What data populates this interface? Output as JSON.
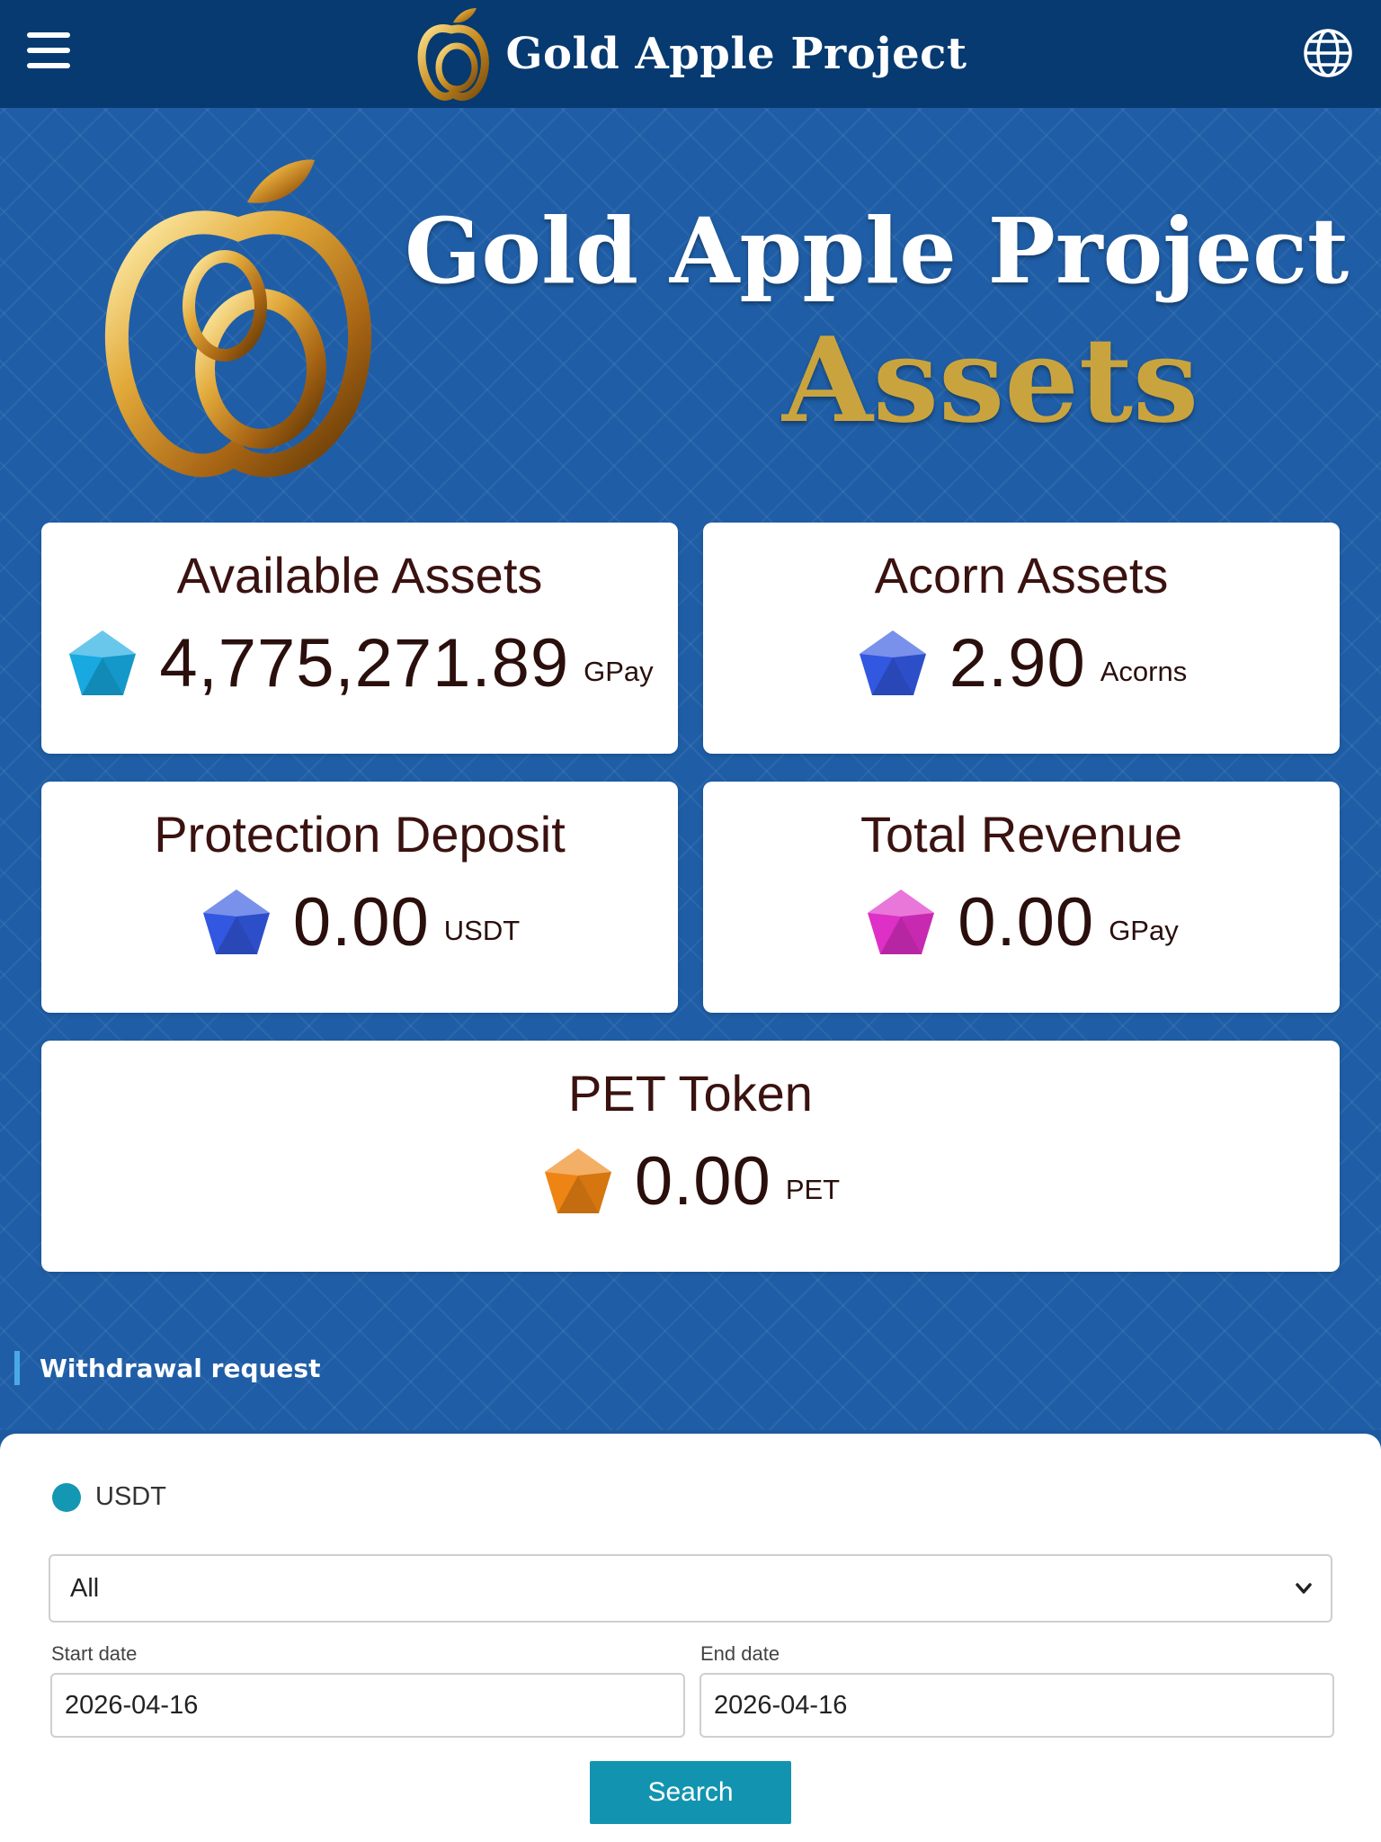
{
  "header": {
    "brand_title": "Gold Apple Project"
  },
  "hero": {
    "title": "Gold Apple Project",
    "subtitle": "Assets"
  },
  "cards": [
    {
      "title": "Available Assets",
      "amount": "4,775,271.89",
      "unit": "GPay",
      "gem_color": "#17a9e0"
    },
    {
      "title": "Acorn Assets",
      "amount": "2.90",
      "unit": "Acorns",
      "gem_color": "#3257e0"
    },
    {
      "title": "Protection Deposit",
      "amount": "0.00",
      "unit": "USDT",
      "gem_color": "#3257e0"
    },
    {
      "title": "Total Revenue",
      "amount": "0.00",
      "unit": "GPay",
      "gem_color": "#de2fc6"
    },
    {
      "title": "PET Token",
      "amount": "0.00",
      "unit": "PET",
      "gem_color": "#ee8414"
    }
  ],
  "section": {
    "label": "Withdrawal request"
  },
  "filters": {
    "currency_option": "USDT",
    "type_select_value": "All",
    "start_date_label": "Start date",
    "start_date_value": "2026-04-16",
    "end_date_label": "End date",
    "end_date_value": "2026-04-16",
    "search_label": "Search"
  },
  "colors": {
    "topbar": "#063a70",
    "hero_bg": "#1f5ea6",
    "accent_gold": "#c9a43e",
    "button_teal": "#1294b0",
    "text_dark": "#2a0f0c"
  },
  "icons": {
    "menu": "hamburger-menu-icon",
    "language": "globe-icon",
    "logo": "gold-apple-logo",
    "dropdown": "chevron-down-icon"
  }
}
